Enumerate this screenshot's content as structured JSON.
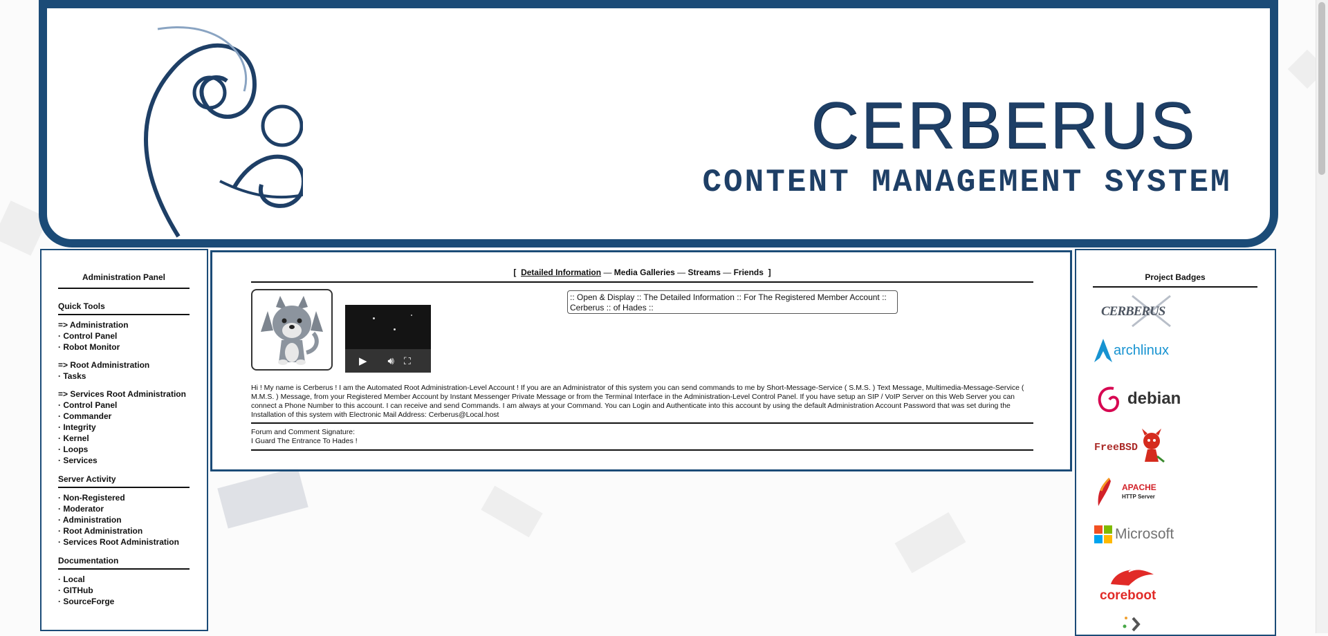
{
  "banner": {
    "title": "CERBERUS",
    "subtitle": "CONTENT MANAGEMENT SYSTEM"
  },
  "left_panel": {
    "heading": "Administration Panel",
    "quick_tools": {
      "title": "Quick Tools",
      "groups": [
        {
          "header": "=> Administration",
          "items": [
            "· Control Panel",
            "· Robot Monitor"
          ]
        },
        {
          "header": "=> Root Administration",
          "items": [
            "· Tasks"
          ]
        },
        {
          "header": "=> Services Root Administration",
          "items": [
            "· Control Panel",
            "· Commander",
            "· Integrity",
            "· Kernel",
            "· Loops",
            "· Services"
          ]
        }
      ]
    },
    "server_activity": {
      "title": "Server Activity",
      "items": [
        "· Non-Registered",
        "· Moderator",
        "· Administration",
        "· Root Administration",
        "· Services Root Administration"
      ]
    },
    "documentation": {
      "title": "Documentation",
      "items": [
        "· Local",
        "· GITHub",
        "· SourceForge"
      ]
    }
  },
  "center": {
    "tabs": {
      "open_bracket": "[",
      "close_bracket": "]",
      "separator": "—",
      "items": [
        "Detailed Information",
        "Media Galleries",
        "Streams",
        "Friends"
      ]
    },
    "info_box": {
      "line1": ":: Open & Display :: The Detailed Information :: For The Registered Member Account ::",
      "line2": "Cerberus :: of Hades ::"
    },
    "bio": "Hi ! My name is Cerberus ! I am the Automated Root Administration-Level Account ! If you are an Administrator of this system you can send commands to me by Short-Message-Service ( S.M.S. ) Text Message, Multimedia-Message-Service ( M.M.S. ) Message, from your Registered Member Account by Instant Messenger Private Message or from the Terminal Interface in the Administration-Level Control Panel. If you have setup an SIP / VoIP Server on this Web Server you can connect a Phone Number to this account. I can receive and send Commands. I am always at your Command. You can Login and Authenticate into this account by using the default Administration Account Password that was set during the Installation of this system with Electronic Mail Address: Cerberus@Local.host",
    "signature_label": "Forum and Comment Signature:",
    "signature_text": "I Guard The Entrance To Hades !"
  },
  "right_panel": {
    "heading": "Project Badges",
    "badges": {
      "cerberus": "CERBERUS",
      "arch": "archlinux",
      "debian": "debian",
      "freebsd": "FreeBSD",
      "apache": "APACHE",
      "apache_sub": "HTTP Server",
      "microsoft": "Microsoft",
      "coreboot": "coreboot"
    }
  },
  "colors": {
    "brand": "#1b4b77",
    "title_text": "#1e3f66"
  }
}
